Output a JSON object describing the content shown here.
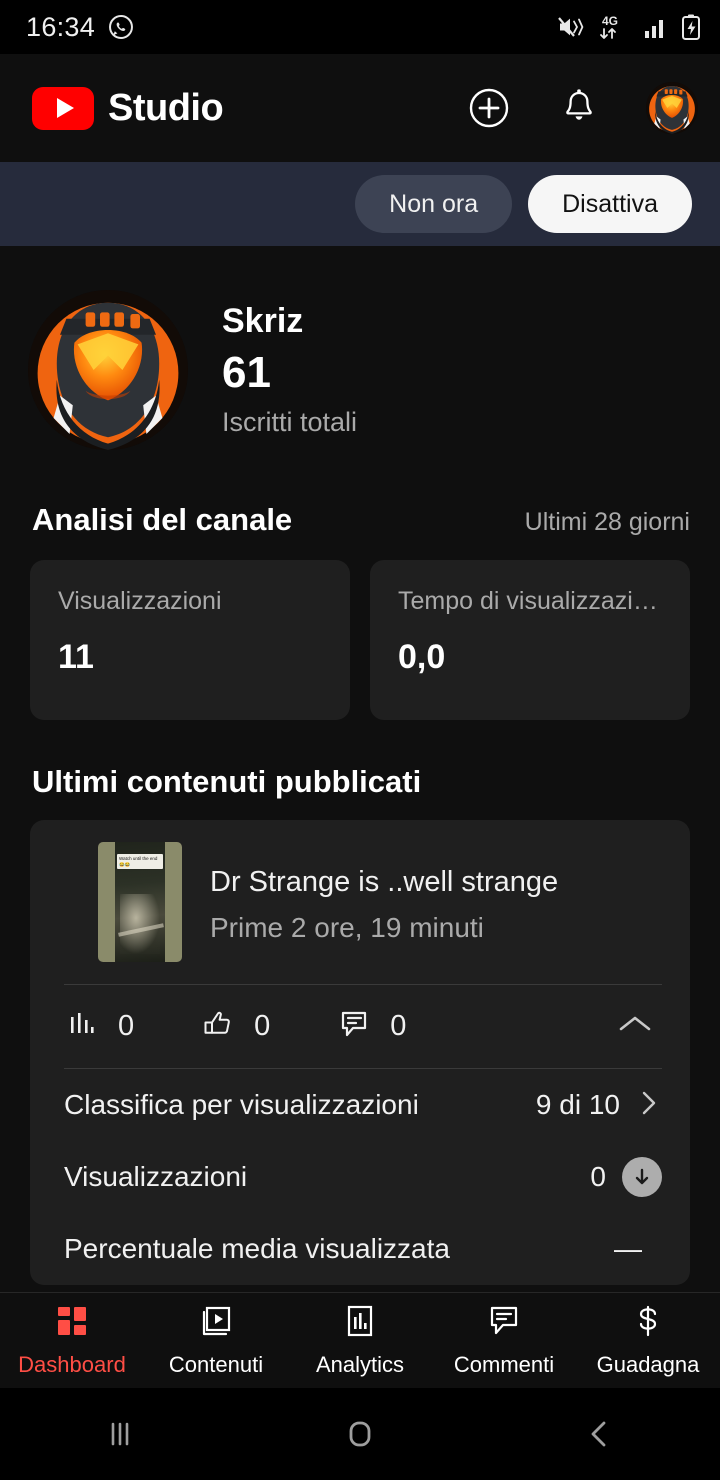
{
  "status_bar": {
    "time": "16:34",
    "icons": [
      "whatsapp-icon",
      "mute-vibrate-icon",
      "4g-data-icon",
      "signal-bars-icon",
      "battery-charging-icon"
    ],
    "network": "4G"
  },
  "header": {
    "app_title": "Studio",
    "logo": "youtube-logo",
    "create_label": "create-icon",
    "notifications_label": "bell-icon",
    "avatar_label": "channel-avatar"
  },
  "banner": {
    "not_now_label": "Non ora",
    "disable_label": "Disattiva",
    "background": "#262b3c"
  },
  "channel": {
    "name": "Skriz",
    "subscriber_count": "61",
    "subscriber_label": "Iscritti totali"
  },
  "analytics": {
    "title": "Analisi del canale",
    "period": "Ultimi 28 giorni",
    "cards": [
      {
        "label": "Visualizzazioni",
        "value": "11"
      },
      {
        "label": "Tempo di visualizzazi…",
        "value": "0,0"
      }
    ]
  },
  "latest_content": {
    "title": "Ultimi contenuti pubblicati",
    "video": {
      "title": "Dr Strange is ..well strange",
      "subtitle": "Prime 2 ore, 19 minuti",
      "thumbnail_caption": "Watch until the end 😂😂",
      "stats": [
        {
          "icon": "impressions-bars-icon",
          "value": "0"
        },
        {
          "icon": "thumbs-up-icon",
          "value": "0"
        },
        {
          "icon": "comment-icon",
          "value": "0"
        }
      ],
      "collapse_icon": "chevron-up-icon",
      "details": [
        {
          "label": "Classifica per visualizzazioni",
          "value": "9 di 10",
          "accessory": "chevron-right-icon"
        },
        {
          "label": "Visualizzazioni",
          "value": "0",
          "accessory": "arrow-down-badge"
        },
        {
          "label": "Percentuale media visualizzata",
          "value": "—",
          "accessory": "none"
        }
      ]
    }
  },
  "bottom_nav": {
    "active_color": "#ff4e45",
    "items": [
      {
        "label": "Dashboard",
        "icon": "dashboard-grid-icon",
        "active": true
      },
      {
        "label": "Contenuti",
        "icon": "video-stack-icon",
        "active": false
      },
      {
        "label": "Analytics",
        "icon": "bar-chart-icon",
        "active": false
      },
      {
        "label": "Commenti",
        "icon": "comment-icon",
        "active": false
      },
      {
        "label": "Guadagna",
        "icon": "dollar-icon",
        "active": false
      }
    ]
  },
  "system_nav": {
    "recents": "recents-icon",
    "home": "home-icon",
    "back": "back-icon"
  }
}
